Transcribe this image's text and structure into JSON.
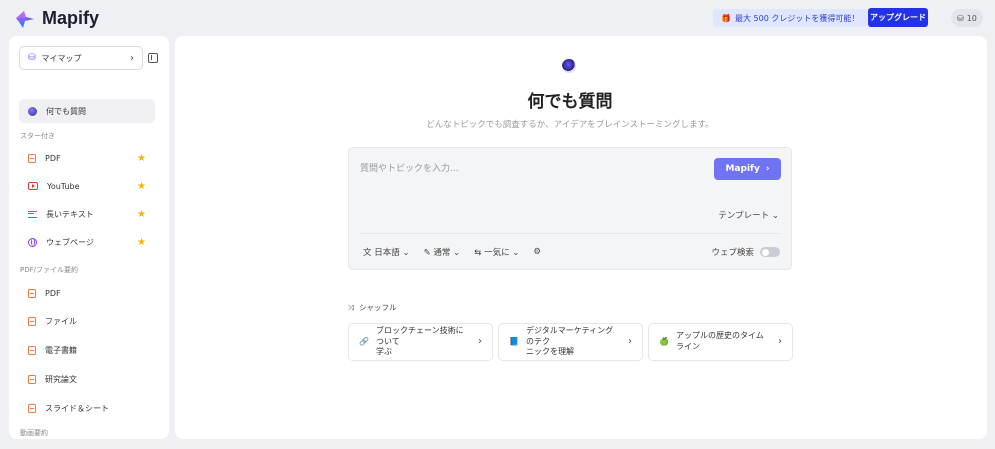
{
  "header": {
    "logo_text": "Mapify",
    "promo_label": "最大 500 クレジットを獲得可能！",
    "upgrade_label": "アップグレード",
    "credits_count": "10"
  },
  "sidebar": {
    "mymap_label": "マイマップ",
    "ask_anything": "何でも質問",
    "starred_section": "スター付き",
    "starred": [
      {
        "label": "PDF",
        "icon": "file-icon"
      },
      {
        "label": "YouTube",
        "icon": "youtube-icon"
      },
      {
        "label": "長いテキスト",
        "icon": "long-text-icon"
      },
      {
        "label": "ウェブページ",
        "icon": "globe-icon"
      }
    ],
    "file_section": "PDF/ファイル要約",
    "files": [
      {
        "label": "PDF"
      },
      {
        "label": "ファイル"
      },
      {
        "label": "電子書籍"
      },
      {
        "label": "研究論文"
      },
      {
        "label": "スライド＆シート"
      }
    ],
    "video_section": "動画要約"
  },
  "main": {
    "title": "何でも質問",
    "subtitle": "どんなトピックでも調査するか、アイデアをブレインストーミングします。",
    "input_placeholder": "質問やトピックを入力...",
    "submit_label": "Mapify",
    "template_label": "テンプレート",
    "options": {
      "language": "日本語",
      "mode": "通常",
      "generation": "一気に"
    },
    "websearch_label": "ウェブ検索",
    "websearch_on": false,
    "shuffle_label": "シャッフル",
    "suggestions": [
      {
        "text": "ブロックチェーン技術について学ぶ",
        "line1": "ブロックチェーン技術について",
        "line2": "学ぶ"
      },
      {
        "text": "デジタルマーケティングのテクニックを理解",
        "line1": "デジタルマーケティングのテク",
        "line2": "ニックを理解"
      },
      {
        "text": "アップルの歴史のタイムライン",
        "line1": "アップルの歴史のタイムライン",
        "line2": ""
      }
    ]
  },
  "colors": {
    "brand": "#6f74f5",
    "upgrade": "#2432e6",
    "star": "#f3b400"
  }
}
